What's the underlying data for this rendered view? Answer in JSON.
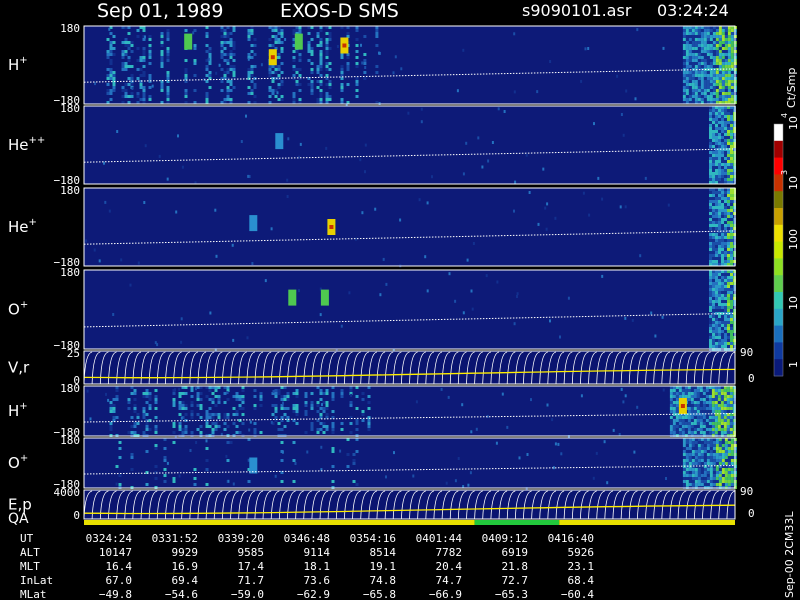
{
  "chart_data": {
    "type": "heatmap",
    "header": {
      "date": "Sep 01, 1989",
      "instrument": "EXOS-D SMS",
      "file": "s9090101.asr",
      "time": "03:24:24"
    },
    "side_label": "Sep-00 2CM33L",
    "colorbar": {
      "title": "Ct/Smp",
      "tick_labels": [
        "1",
        "10",
        "100",
        "10",
        "3",
        "10",
        "4"
      ],
      "colors": [
        "#0a1a7a",
        "#0f3aa0",
        "#1a6fbd",
        "#2aa6c8",
        "#32c8b4",
        "#5fce4e",
        "#8ee021",
        "#c8e800",
        "#eee000",
        "#c8a000",
        "#7a7a00",
        "#c83200",
        "#ff0000",
        "#a00000",
        "#ffffff"
      ]
    },
    "panels": [
      {
        "label": "H",
        "sup": "+",
        "ytop": "180",
        "ybot": "−180",
        "kind": "spectrogram",
        "hot": [
          [
            0.16,
            0.2,
            0.7
          ],
          [
            0.29,
            0.4,
            0.9
          ],
          [
            0.33,
            0.2,
            0.8
          ],
          [
            0.4,
            0.25,
            1.0
          ]
        ],
        "activity": [
          [
            0.03,
            0.42,
            0.55
          ],
          [
            0.42,
            0.48,
            0.25
          ]
        ],
        "edge_activity": 0.92
      },
      {
        "label": "He",
        "sup": "++",
        "ytop": "180",
        "ybot": "−180",
        "kind": "spectrogram",
        "hot": [
          [
            0.3,
            0.45,
            0.35
          ]
        ],
        "activity": [],
        "edge_activity": 0.96
      },
      {
        "label": "He",
        "sup": "+",
        "ytop": "180",
        "ybot": "−180",
        "kind": "spectrogram",
        "hot": [
          [
            0.26,
            0.45,
            0.35
          ],
          [
            0.38,
            0.5,
            0.9
          ]
        ],
        "activity": [],
        "edge_activity": 0.96
      },
      {
        "label": "O",
        "sup": "+",
        "ytop": "180",
        "ybot": "−180",
        "kind": "spectrogram",
        "hot": [
          [
            0.32,
            0.35,
            0.8
          ],
          [
            0.37,
            0.35,
            0.8
          ]
        ],
        "activity": [],
        "edge_activity": 0.96
      },
      {
        "label": "V,r",
        "sup": "",
        "ytop": "25",
        "ybot": "0",
        "right_top": "90",
        "right_bot": "0",
        "kind": "lines"
      },
      {
        "label": "H",
        "sup": "+",
        "ytop": "180",
        "ybot": "−180",
        "kind": "spectrogram",
        "hot": [
          [
            0.92,
            0.4,
            1.0
          ]
        ],
        "activity": [
          [
            0.03,
            0.45,
            0.5
          ]
        ],
        "edge_activity": 0.9
      },
      {
        "label": "O",
        "sup": "+",
        "ytop": "180",
        "ybot": "−180",
        "kind": "spectrogram",
        "hot": [
          [
            0.26,
            0.55,
            0.6
          ]
        ],
        "activity": [
          [
            0.03,
            0.45,
            0.18
          ]
        ],
        "edge_activity": 0.92
      },
      {
        "label": "E,p",
        "sup": "",
        "ytop": "4000",
        "ybot": "0",
        "right_top": "90",
        "right_bot": "0",
        "kind": "lines"
      }
    ],
    "qa_label": "QA",
    "qa_segments": [
      {
        "from": 0.0,
        "to": 0.6,
        "color": "#e8e000"
      },
      {
        "from": 0.6,
        "to": 0.73,
        "color": "#22c83c"
      },
      {
        "from": 0.73,
        "to": 1.0,
        "color": "#e8e000"
      }
    ],
    "orbit_table": {
      "rows": [
        {
          "label": "UT",
          "values": [
            "0324:24",
            "0331:52",
            "0339:20",
            "0346:48",
            "0354:16",
            "0401:44",
            "0409:12",
            "0416:40"
          ]
        },
        {
          "label": "ALT",
          "values": [
            "10147",
            "9929",
            "9585",
            "9114",
            "8514",
            "7782",
            "6919",
            "5926"
          ]
        },
        {
          "label": "MLT",
          "values": [
            "16.4",
            "16.9",
            "17.4",
            "18.1",
            "19.1",
            "20.4",
            "21.8",
            "23.1"
          ]
        },
        {
          "label": "InLat",
          "values": [
            "67.0",
            "69.4",
            "71.7",
            "73.6",
            "74.8",
            "74.7",
            "72.7",
            "68.4"
          ]
        },
        {
          "label": "MLat",
          "values": [
            "−49.8",
            "−54.6",
            "−59.0",
            "−62.9",
            "−65.8",
            "−66.9",
            "−65.3",
            "−60.4"
          ]
        }
      ]
    }
  }
}
